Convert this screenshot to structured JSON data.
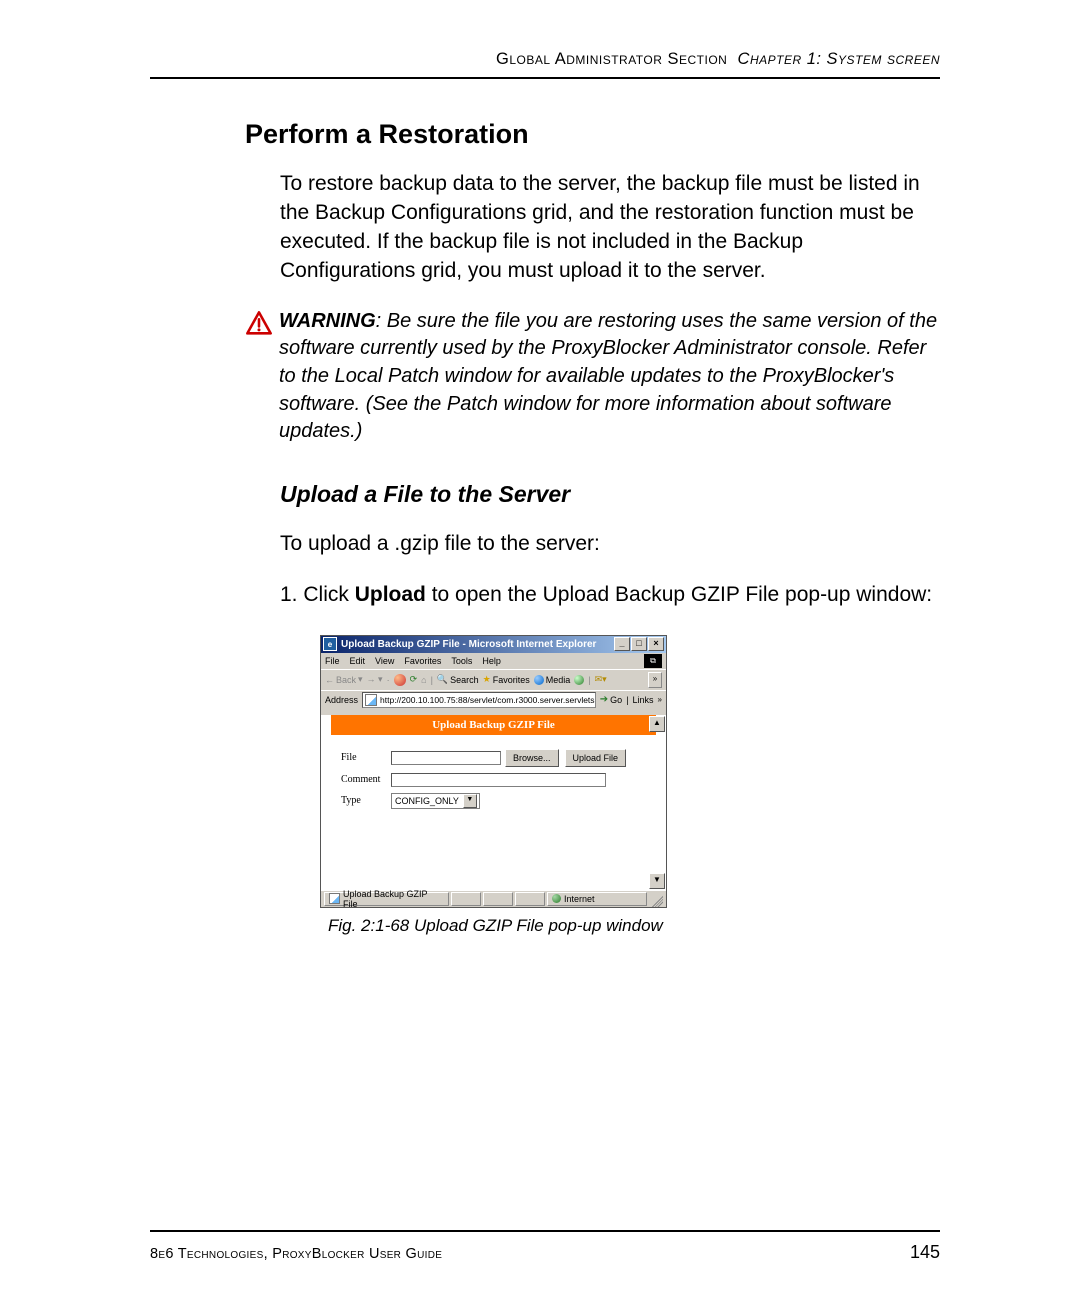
{
  "header": {
    "left": "Global Administrator Section",
    "right_italic": "Chapter 1: System screen"
  },
  "section_title": "Perform a Restoration",
  "intro_paragraph": "To restore backup data to the server, the backup file must be listed in the Backup Configurations grid, and the restoration function must be executed. If the backup file is not included in the Backup Configurations grid, you must upload it to the server.",
  "warning": {
    "label": "WARNING",
    "text": ": Be sure the file you are restoring uses the same version of the software currently used by the ProxyBlocker Administrator console. Refer to the Local Patch window for available updates to the ProxyBlocker's software. (See the Patch window for more information about software updates.)"
  },
  "subheading": "Upload a File to the Server",
  "sub_intro": "To upload a .gzip file to the server:",
  "step1_a": "1. ",
  "step1_b": "Click ",
  "step1_bold": "Upload",
  "step1_c": " to open the Upload Backup GZIP File pop-up window:",
  "figure_caption": "Fig. 2:1-68  Upload GZIP File pop-up window",
  "ie": {
    "title": "Upload Backup GZIP File - Microsoft Internet Explorer",
    "menus": [
      "File",
      "Edit",
      "View",
      "Favorites",
      "Tools",
      "Help"
    ],
    "toolbar": {
      "back": "Back",
      "search": "Search",
      "favorites": "Favorites",
      "media": "Media"
    },
    "address_label": "Address",
    "address_value": "http://200.10.100.75:88/servlet/com.r3000.server.servlets.",
    "go": "Go",
    "links": "Links",
    "banner": "Upload Backup GZIP File",
    "fields": {
      "file_label": "File",
      "browse": "Browse...",
      "upload": "Upload File",
      "comment_label": "Comment",
      "type_label": "Type",
      "type_value": "CONFIG_ONLY"
    },
    "status_left": "Upload Backup GZIP File",
    "status_right": "Internet",
    "winbtns": {
      "min": "_",
      "max": "□",
      "close": "×"
    }
  },
  "footer": {
    "left": "8e6 Technologies, ProxyBlocker User Guide",
    "page": "145"
  }
}
